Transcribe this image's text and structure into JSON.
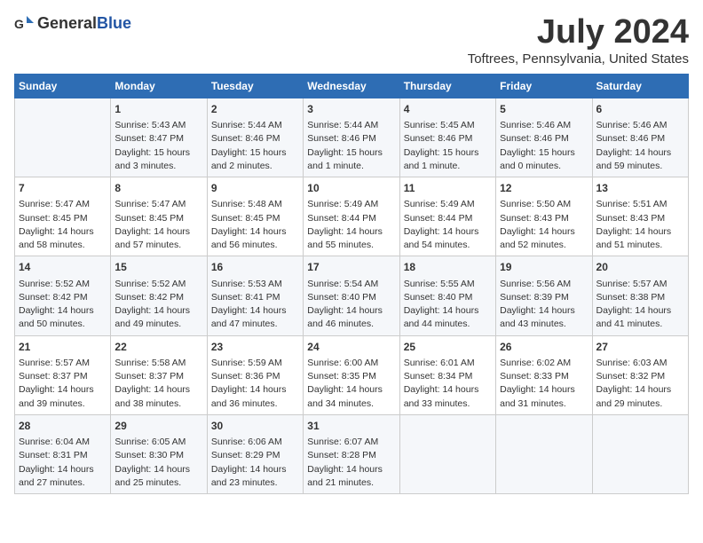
{
  "logo": {
    "general": "General",
    "blue": "Blue"
  },
  "title": {
    "month_year": "July 2024",
    "location": "Toftrees, Pennsylvania, United States"
  },
  "weekdays": [
    "Sunday",
    "Monday",
    "Tuesday",
    "Wednesday",
    "Thursday",
    "Friday",
    "Saturday"
  ],
  "weeks": [
    [
      {
        "day": "",
        "lines": []
      },
      {
        "day": "1",
        "lines": [
          "Sunrise: 5:43 AM",
          "Sunset: 8:47 PM",
          "Daylight: 15 hours",
          "and 3 minutes."
        ]
      },
      {
        "day": "2",
        "lines": [
          "Sunrise: 5:44 AM",
          "Sunset: 8:46 PM",
          "Daylight: 15 hours",
          "and 2 minutes."
        ]
      },
      {
        "day": "3",
        "lines": [
          "Sunrise: 5:44 AM",
          "Sunset: 8:46 PM",
          "Daylight: 15 hours",
          "and 1 minute."
        ]
      },
      {
        "day": "4",
        "lines": [
          "Sunrise: 5:45 AM",
          "Sunset: 8:46 PM",
          "Daylight: 15 hours",
          "and 1 minute."
        ]
      },
      {
        "day": "5",
        "lines": [
          "Sunrise: 5:46 AM",
          "Sunset: 8:46 PM",
          "Daylight: 15 hours",
          "and 0 minutes."
        ]
      },
      {
        "day": "6",
        "lines": [
          "Sunrise: 5:46 AM",
          "Sunset: 8:46 PM",
          "Daylight: 14 hours",
          "and 59 minutes."
        ]
      }
    ],
    [
      {
        "day": "7",
        "lines": [
          "Sunrise: 5:47 AM",
          "Sunset: 8:45 PM",
          "Daylight: 14 hours",
          "and 58 minutes."
        ]
      },
      {
        "day": "8",
        "lines": [
          "Sunrise: 5:47 AM",
          "Sunset: 8:45 PM",
          "Daylight: 14 hours",
          "and 57 minutes."
        ]
      },
      {
        "day": "9",
        "lines": [
          "Sunrise: 5:48 AM",
          "Sunset: 8:45 PM",
          "Daylight: 14 hours",
          "and 56 minutes."
        ]
      },
      {
        "day": "10",
        "lines": [
          "Sunrise: 5:49 AM",
          "Sunset: 8:44 PM",
          "Daylight: 14 hours",
          "and 55 minutes."
        ]
      },
      {
        "day": "11",
        "lines": [
          "Sunrise: 5:49 AM",
          "Sunset: 8:44 PM",
          "Daylight: 14 hours",
          "and 54 minutes."
        ]
      },
      {
        "day": "12",
        "lines": [
          "Sunrise: 5:50 AM",
          "Sunset: 8:43 PM",
          "Daylight: 14 hours",
          "and 52 minutes."
        ]
      },
      {
        "day": "13",
        "lines": [
          "Sunrise: 5:51 AM",
          "Sunset: 8:43 PM",
          "Daylight: 14 hours",
          "and 51 minutes."
        ]
      }
    ],
    [
      {
        "day": "14",
        "lines": [
          "Sunrise: 5:52 AM",
          "Sunset: 8:42 PM",
          "Daylight: 14 hours",
          "and 50 minutes."
        ]
      },
      {
        "day": "15",
        "lines": [
          "Sunrise: 5:52 AM",
          "Sunset: 8:42 PM",
          "Daylight: 14 hours",
          "and 49 minutes."
        ]
      },
      {
        "day": "16",
        "lines": [
          "Sunrise: 5:53 AM",
          "Sunset: 8:41 PM",
          "Daylight: 14 hours",
          "and 47 minutes."
        ]
      },
      {
        "day": "17",
        "lines": [
          "Sunrise: 5:54 AM",
          "Sunset: 8:40 PM",
          "Daylight: 14 hours",
          "and 46 minutes."
        ]
      },
      {
        "day": "18",
        "lines": [
          "Sunrise: 5:55 AM",
          "Sunset: 8:40 PM",
          "Daylight: 14 hours",
          "and 44 minutes."
        ]
      },
      {
        "day": "19",
        "lines": [
          "Sunrise: 5:56 AM",
          "Sunset: 8:39 PM",
          "Daylight: 14 hours",
          "and 43 minutes."
        ]
      },
      {
        "day": "20",
        "lines": [
          "Sunrise: 5:57 AM",
          "Sunset: 8:38 PM",
          "Daylight: 14 hours",
          "and 41 minutes."
        ]
      }
    ],
    [
      {
        "day": "21",
        "lines": [
          "Sunrise: 5:57 AM",
          "Sunset: 8:37 PM",
          "Daylight: 14 hours",
          "and 39 minutes."
        ]
      },
      {
        "day": "22",
        "lines": [
          "Sunrise: 5:58 AM",
          "Sunset: 8:37 PM",
          "Daylight: 14 hours",
          "and 38 minutes."
        ]
      },
      {
        "day": "23",
        "lines": [
          "Sunrise: 5:59 AM",
          "Sunset: 8:36 PM",
          "Daylight: 14 hours",
          "and 36 minutes."
        ]
      },
      {
        "day": "24",
        "lines": [
          "Sunrise: 6:00 AM",
          "Sunset: 8:35 PM",
          "Daylight: 14 hours",
          "and 34 minutes."
        ]
      },
      {
        "day": "25",
        "lines": [
          "Sunrise: 6:01 AM",
          "Sunset: 8:34 PM",
          "Daylight: 14 hours",
          "and 33 minutes."
        ]
      },
      {
        "day": "26",
        "lines": [
          "Sunrise: 6:02 AM",
          "Sunset: 8:33 PM",
          "Daylight: 14 hours",
          "and 31 minutes."
        ]
      },
      {
        "day": "27",
        "lines": [
          "Sunrise: 6:03 AM",
          "Sunset: 8:32 PM",
          "Daylight: 14 hours",
          "and 29 minutes."
        ]
      }
    ],
    [
      {
        "day": "28",
        "lines": [
          "Sunrise: 6:04 AM",
          "Sunset: 8:31 PM",
          "Daylight: 14 hours",
          "and 27 minutes."
        ]
      },
      {
        "day": "29",
        "lines": [
          "Sunrise: 6:05 AM",
          "Sunset: 8:30 PM",
          "Daylight: 14 hours",
          "and 25 minutes."
        ]
      },
      {
        "day": "30",
        "lines": [
          "Sunrise: 6:06 AM",
          "Sunset: 8:29 PM",
          "Daylight: 14 hours",
          "and 23 minutes."
        ]
      },
      {
        "day": "31",
        "lines": [
          "Sunrise: 6:07 AM",
          "Sunset: 8:28 PM",
          "Daylight: 14 hours",
          "and 21 minutes."
        ]
      },
      {
        "day": "",
        "lines": []
      },
      {
        "day": "",
        "lines": []
      },
      {
        "day": "",
        "lines": []
      }
    ]
  ]
}
